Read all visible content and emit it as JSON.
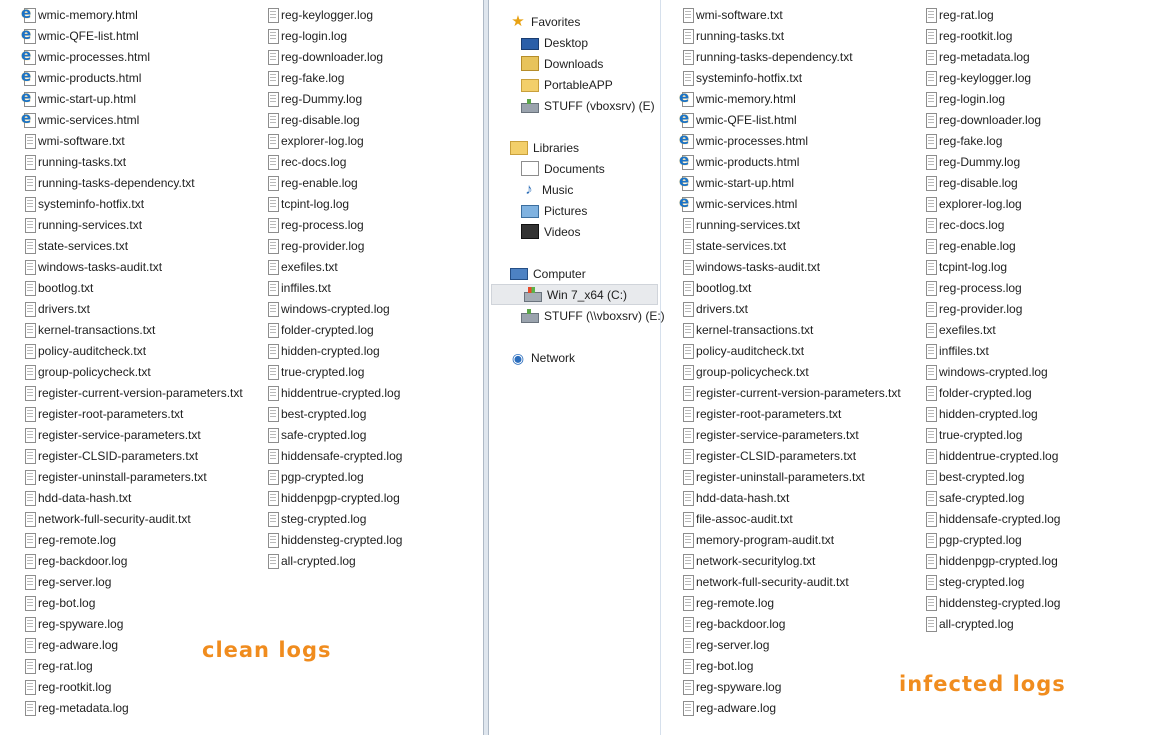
{
  "left_panel": {
    "caption": "clean logs",
    "columns": [
      [
        {
          "name": "wmic-memory.html",
          "icon": "html-file-icon"
        },
        {
          "name": "wmic-QFE-list.html",
          "icon": "html-file-icon"
        },
        {
          "name": "wmic-processes.html",
          "icon": "html-file-icon"
        },
        {
          "name": "wmic-products.html",
          "icon": "html-file-icon"
        },
        {
          "name": "wmic-start-up.html",
          "icon": "html-file-icon"
        },
        {
          "name": "wmic-services.html",
          "icon": "html-file-icon"
        },
        {
          "name": "wmi-software.txt",
          "icon": "text-file-icon"
        },
        {
          "name": "running-tasks.txt",
          "icon": "text-file-icon"
        },
        {
          "name": "running-tasks-dependency.txt",
          "icon": "text-file-icon"
        },
        {
          "name": "systeminfo-hotfix.txt",
          "icon": "text-file-icon"
        },
        {
          "name": "running-services.txt",
          "icon": "text-file-icon"
        },
        {
          "name": "state-services.txt",
          "icon": "text-file-icon"
        },
        {
          "name": "windows-tasks-audit.txt",
          "icon": "text-file-icon"
        },
        {
          "name": "bootlog.txt",
          "icon": "text-file-icon"
        },
        {
          "name": "drivers.txt",
          "icon": "text-file-icon"
        },
        {
          "name": "kernel-transactions.txt",
          "icon": "text-file-icon"
        },
        {
          "name": "policy-auditcheck.txt",
          "icon": "text-file-icon"
        },
        {
          "name": "group-policycheck.txt",
          "icon": "text-file-icon"
        },
        {
          "name": "register-current-version-parameters.txt",
          "icon": "text-file-icon"
        },
        {
          "name": "register-root-parameters.txt",
          "icon": "text-file-icon"
        },
        {
          "name": "register-service-parameters.txt",
          "icon": "text-file-icon"
        },
        {
          "name": "register-CLSID-parameters.txt",
          "icon": "text-file-icon"
        },
        {
          "name": "register-uninstall-parameters.txt",
          "icon": "text-file-icon"
        },
        {
          "name": "hdd-data-hash.txt",
          "icon": "text-file-icon"
        },
        {
          "name": "network-full-security-audit.txt",
          "icon": "text-file-icon"
        },
        {
          "name": "reg-remote.log",
          "icon": "text-file-icon"
        },
        {
          "name": "reg-backdoor.log",
          "icon": "text-file-icon"
        },
        {
          "name": "reg-server.log",
          "icon": "text-file-icon"
        },
        {
          "name": "reg-bot.log",
          "icon": "text-file-icon"
        },
        {
          "name": "reg-spyware.log",
          "icon": "text-file-icon"
        },
        {
          "name": "reg-adware.log",
          "icon": "text-file-icon"
        },
        {
          "name": "reg-rat.log",
          "icon": "text-file-icon"
        },
        {
          "name": "reg-rootkit.log",
          "icon": "text-file-icon"
        },
        {
          "name": "reg-metadata.log",
          "icon": "text-file-icon"
        }
      ],
      [
        {
          "name": "reg-keylogger.log",
          "icon": "text-file-icon"
        },
        {
          "name": "reg-login.log",
          "icon": "text-file-icon"
        },
        {
          "name": "reg-downloader.log",
          "icon": "text-file-icon"
        },
        {
          "name": "reg-fake.log",
          "icon": "text-file-icon"
        },
        {
          "name": "reg-Dummy.log",
          "icon": "text-file-icon"
        },
        {
          "name": "reg-disable.log",
          "icon": "text-file-icon"
        },
        {
          "name": "explorer-log.log",
          "icon": "text-file-icon"
        },
        {
          "name": "rec-docs.log",
          "icon": "text-file-icon"
        },
        {
          "name": "reg-enable.log",
          "icon": "text-file-icon"
        },
        {
          "name": "tcpint-log.log",
          "icon": "text-file-icon"
        },
        {
          "name": "reg-process.log",
          "icon": "text-file-icon"
        },
        {
          "name": "reg-provider.log",
          "icon": "text-file-icon"
        },
        {
          "name": "exefiles.txt",
          "icon": "text-file-icon"
        },
        {
          "name": "inffiles.txt",
          "icon": "text-file-icon"
        },
        {
          "name": "windows-crypted.log",
          "icon": "text-file-icon"
        },
        {
          "name": "folder-crypted.log",
          "icon": "text-file-icon"
        },
        {
          "name": "hidden-crypted.log",
          "icon": "text-file-icon"
        },
        {
          "name": "true-crypted.log",
          "icon": "text-file-icon"
        },
        {
          "name": "hiddentrue-crypted.log",
          "icon": "text-file-icon"
        },
        {
          "name": "best-crypted.log",
          "icon": "text-file-icon"
        },
        {
          "name": "safe-crypted.log",
          "icon": "text-file-icon"
        },
        {
          "name": "hiddensafe-crypted.log",
          "icon": "text-file-icon"
        },
        {
          "name": "pgp-crypted.log",
          "icon": "text-file-icon"
        },
        {
          "name": "hiddenpgp-crypted.log",
          "icon": "text-file-icon"
        },
        {
          "name": "steg-crypted.log",
          "icon": "text-file-icon"
        },
        {
          "name": "hiddensteg-crypted.log",
          "icon": "text-file-icon"
        },
        {
          "name": "all-crypted.log",
          "icon": "text-file-icon"
        }
      ]
    ]
  },
  "navigation": {
    "favorites": {
      "label": "Favorites",
      "items": [
        {
          "label": "Desktop",
          "icon": "desktop-icon"
        },
        {
          "label": "Downloads",
          "icon": "downloads-icon"
        },
        {
          "label": "PortableAPP",
          "icon": "folder-icon"
        },
        {
          "label": "STUFF (vboxsrv) (E)",
          "icon": "network-drive-icon"
        }
      ]
    },
    "libraries": {
      "label": "Libraries",
      "items": [
        {
          "label": "Documents",
          "icon": "documents-icon"
        },
        {
          "label": "Music",
          "icon": "music-icon"
        },
        {
          "label": "Pictures",
          "icon": "pictures-icon"
        },
        {
          "label": "Videos",
          "icon": "videos-icon"
        }
      ]
    },
    "computer": {
      "label": "Computer",
      "items": [
        {
          "label": "Win 7_x64 (C:)",
          "icon": "windows-drive-icon",
          "selected": true
        },
        {
          "label": "STUFF (\\\\vboxsrv) (E:)",
          "icon": "network-drive-icon",
          "selected": false
        }
      ]
    },
    "network": {
      "label": "Network"
    }
  },
  "right_panel": {
    "caption": "infected logs",
    "columns": [
      [
        {
          "name": "wmi-software.txt",
          "icon": "text-file-icon"
        },
        {
          "name": "running-tasks.txt",
          "icon": "text-file-icon"
        },
        {
          "name": "running-tasks-dependency.txt",
          "icon": "text-file-icon"
        },
        {
          "name": "systeminfo-hotfix.txt",
          "icon": "text-file-icon"
        },
        {
          "name": "wmic-memory.html",
          "icon": "html-file-icon"
        },
        {
          "name": "wmic-QFE-list.html",
          "icon": "html-file-icon"
        },
        {
          "name": "wmic-processes.html",
          "icon": "html-file-icon"
        },
        {
          "name": "wmic-products.html",
          "icon": "html-file-icon"
        },
        {
          "name": "wmic-start-up.html",
          "icon": "html-file-icon"
        },
        {
          "name": "wmic-services.html",
          "icon": "html-file-icon"
        },
        {
          "name": "running-services.txt",
          "icon": "text-file-icon"
        },
        {
          "name": "state-services.txt",
          "icon": "text-file-icon"
        },
        {
          "name": "windows-tasks-audit.txt",
          "icon": "text-file-icon"
        },
        {
          "name": "bootlog.txt",
          "icon": "text-file-icon"
        },
        {
          "name": "drivers.txt",
          "icon": "text-file-icon"
        },
        {
          "name": "kernel-transactions.txt",
          "icon": "text-file-icon"
        },
        {
          "name": "policy-auditcheck.txt",
          "icon": "text-file-icon"
        },
        {
          "name": "group-policycheck.txt",
          "icon": "text-file-icon"
        },
        {
          "name": "register-current-version-parameters.txt",
          "icon": "text-file-icon"
        },
        {
          "name": "register-root-parameters.txt",
          "icon": "text-file-icon"
        },
        {
          "name": "register-service-parameters.txt",
          "icon": "text-file-icon"
        },
        {
          "name": "register-CLSID-parameters.txt",
          "icon": "text-file-icon"
        },
        {
          "name": "register-uninstall-parameters.txt",
          "icon": "text-file-icon"
        },
        {
          "name": "hdd-data-hash.txt",
          "icon": "text-file-icon"
        },
        {
          "name": "file-assoc-audit.txt",
          "icon": "text-file-icon"
        },
        {
          "name": "memory-program-audit.txt",
          "icon": "text-file-icon"
        },
        {
          "name": "network-securitylog.txt",
          "icon": "text-file-icon"
        },
        {
          "name": "network-full-security-audit.txt",
          "icon": "text-file-icon"
        },
        {
          "name": "reg-remote.log",
          "icon": "text-file-icon"
        },
        {
          "name": "reg-backdoor.log",
          "icon": "text-file-icon"
        },
        {
          "name": "reg-server.log",
          "icon": "text-file-icon"
        },
        {
          "name": "reg-bot.log",
          "icon": "text-file-icon"
        },
        {
          "name": "reg-spyware.log",
          "icon": "text-file-icon"
        },
        {
          "name": "reg-adware.log",
          "icon": "text-file-icon"
        }
      ],
      [
        {
          "name": "reg-rat.log",
          "icon": "text-file-icon"
        },
        {
          "name": "reg-rootkit.log",
          "icon": "text-file-icon"
        },
        {
          "name": "reg-metadata.log",
          "icon": "text-file-icon"
        },
        {
          "name": "reg-keylogger.log",
          "icon": "text-file-icon"
        },
        {
          "name": "reg-login.log",
          "icon": "text-file-icon"
        },
        {
          "name": "reg-downloader.log",
          "icon": "text-file-icon"
        },
        {
          "name": "reg-fake.log",
          "icon": "text-file-icon"
        },
        {
          "name": "reg-Dummy.log",
          "icon": "text-file-icon"
        },
        {
          "name": "reg-disable.log",
          "icon": "text-file-icon"
        },
        {
          "name": "explorer-log.log",
          "icon": "text-file-icon"
        },
        {
          "name": "rec-docs.log",
          "icon": "text-file-icon"
        },
        {
          "name": "reg-enable.log",
          "icon": "text-file-icon"
        },
        {
          "name": "tcpint-log.log",
          "icon": "text-file-icon"
        },
        {
          "name": "reg-process.log",
          "icon": "text-file-icon"
        },
        {
          "name": "reg-provider.log",
          "icon": "text-file-icon"
        },
        {
          "name": "exefiles.txt",
          "icon": "text-file-icon"
        },
        {
          "name": "inffiles.txt",
          "icon": "text-file-icon"
        },
        {
          "name": "windows-crypted.log",
          "icon": "text-file-icon"
        },
        {
          "name": "folder-crypted.log",
          "icon": "text-file-icon"
        },
        {
          "name": "hidden-crypted.log",
          "icon": "text-file-icon"
        },
        {
          "name": "true-crypted.log",
          "icon": "text-file-icon"
        },
        {
          "name": "hiddentrue-crypted.log",
          "icon": "text-file-icon"
        },
        {
          "name": "best-crypted.log",
          "icon": "text-file-icon"
        },
        {
          "name": "safe-crypted.log",
          "icon": "text-file-icon"
        },
        {
          "name": "hiddensafe-crypted.log",
          "icon": "text-file-icon"
        },
        {
          "name": "pgp-crypted.log",
          "icon": "text-file-icon"
        },
        {
          "name": "hiddenpgp-crypted.log",
          "icon": "text-file-icon"
        },
        {
          "name": "steg-crypted.log",
          "icon": "text-file-icon"
        },
        {
          "name": "hiddensteg-crypted.log",
          "icon": "text-file-icon"
        },
        {
          "name": "all-crypted.log",
          "icon": "text-file-icon"
        }
      ]
    ]
  },
  "colors": {
    "caption": "#f08c1e",
    "nav_selected": "#e8eaed",
    "divider": "#aeb9c6"
  }
}
